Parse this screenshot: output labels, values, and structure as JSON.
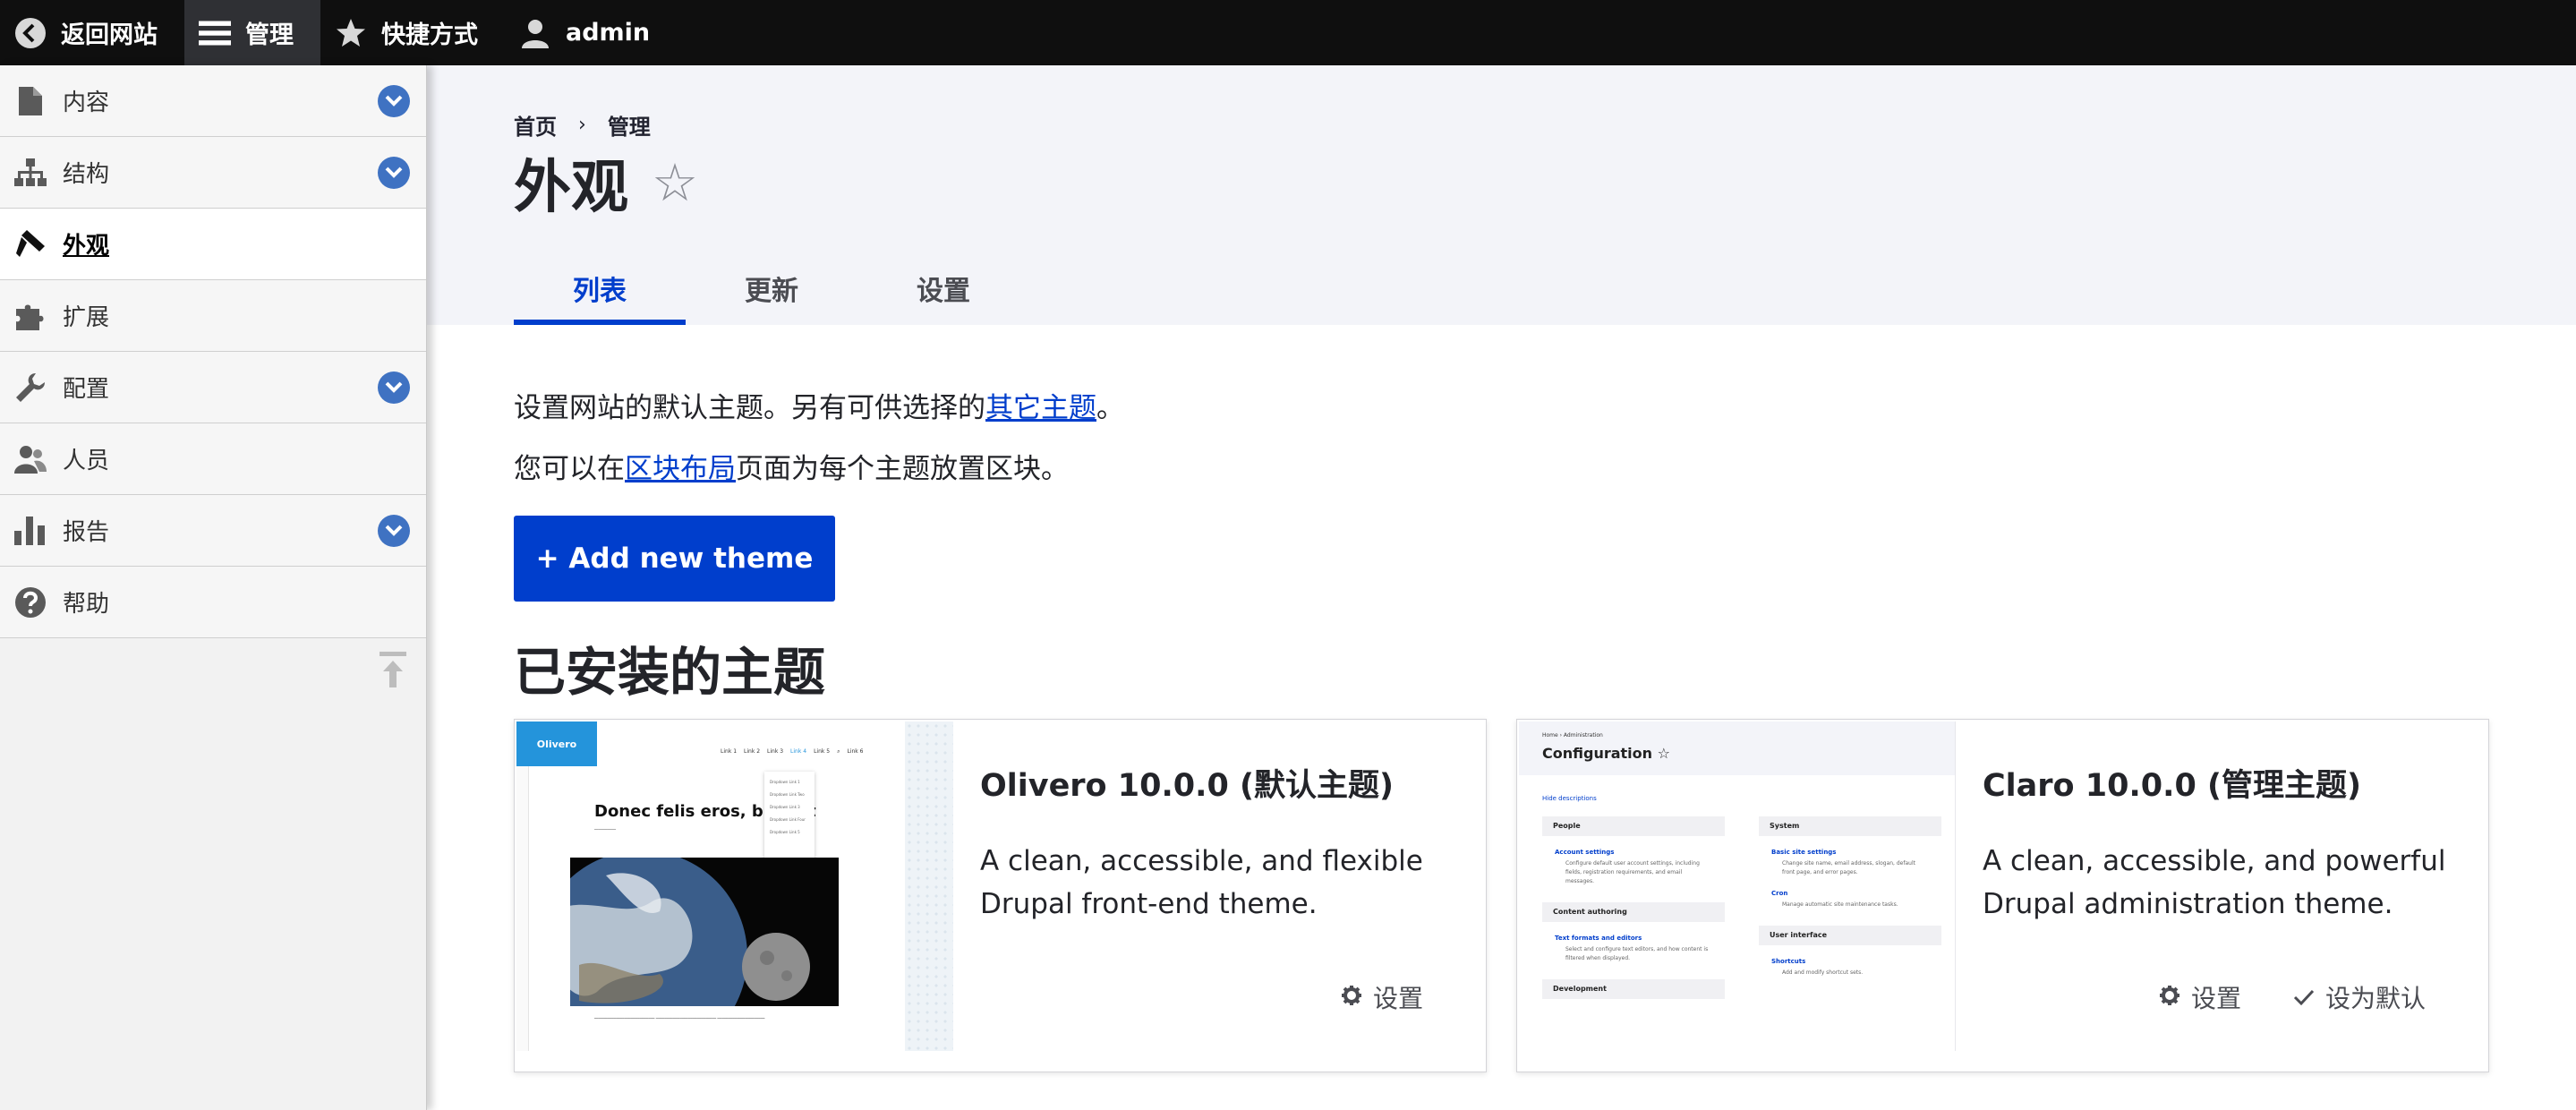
{
  "toolbar": {
    "back_label": "返回网站",
    "manage_label": "管理",
    "shortcuts_label": "快捷方式",
    "user_label": "admin"
  },
  "sidebar": {
    "items": [
      {
        "label": "内容",
        "icon": "file-icon",
        "expandable": true
      },
      {
        "label": "结构",
        "icon": "sitemap-icon",
        "expandable": true
      },
      {
        "label": "外观",
        "icon": "paintbrush-icon",
        "expandable": false,
        "active": true
      },
      {
        "label": "扩展",
        "icon": "puzzle-icon",
        "expandable": false
      },
      {
        "label": "配置",
        "icon": "wrench-icon",
        "expandable": true
      },
      {
        "label": "人员",
        "icon": "people-icon",
        "expandable": false
      },
      {
        "label": "报告",
        "icon": "bar-chart-icon",
        "expandable": true
      },
      {
        "label": "帮助",
        "icon": "help-icon",
        "expandable": false
      }
    ]
  },
  "breadcrumb": {
    "home": "首页",
    "separator": "›",
    "admin": "管理"
  },
  "page": {
    "title": "外观",
    "star": "☆"
  },
  "tabs": [
    {
      "label": "列表",
      "active": true
    },
    {
      "label": "更新",
      "active": false
    },
    {
      "label": "设置",
      "active": false
    }
  ],
  "content": {
    "desc1_prefix": "设置网站的默认主题。另有可供选择的",
    "desc1_link": "其它主题",
    "desc1_suffix": "。",
    "desc2_prefix": "您可以在",
    "desc2_link": "区块布局",
    "desc2_suffix": "页面为每个主题放置区块。",
    "add_button": "+ Add new theme",
    "installed_heading": "已安装的主题"
  },
  "themes": [
    {
      "name": "Olivero 10.0.0 (默认主题)",
      "description": "A clean, accessible, and flexible Drupal front-end theme.",
      "settings_label": "设置",
      "preview": {
        "logo": "Olivero",
        "nav": [
          "Link 1",
          "Link 2",
          "Link 3",
          "Link 4",
          "Link 5",
          "Link 6"
        ],
        "heading": "Donec felis eros, blandit",
        "dropdown": [
          "Dropdown Link 1",
          "Dropdown Link Two",
          "Dropdown Link 3",
          "Dropdown Link Four",
          "Dropdown Link 5"
        ]
      }
    },
    {
      "name": "Claro 10.0.0 (管理主题)",
      "description": "A clean, accessible, and powerful Drupal administration theme.",
      "settings_label": "设置",
      "default_label": "设为默认",
      "preview": {
        "crumb": "Home  ›  Administration",
        "title": "Configuration ☆",
        "hide": "Hide descriptions",
        "people": "People",
        "account_settings": "Account settings",
        "account_desc": "Configure default user account settings, including fields, registration requirements, and email messages.",
        "content_authoring": "Content authoring",
        "text_formats": "Text formats and editors",
        "text_formats_desc": "Select and configure text editors, and how content is filtered when displayed.",
        "development": "Development",
        "system": "System",
        "basic_site": "Basic site settings",
        "basic_site_desc": "Change site name, email address, slogan, default front page, and error pages.",
        "cron": "Cron",
        "cron_desc": "Manage automatic site maintenance tasks.",
        "user_interface": "User interface",
        "shortcuts": "Shortcuts",
        "shortcuts_desc": "Add and modify shortcut sets."
      }
    }
  ],
  "colors": {
    "toolbar_bg": "#0f0f0f",
    "accent": "#003ecc",
    "sidebar_chevron": "#3f72c2",
    "header_bg": "#f3f4f9"
  }
}
